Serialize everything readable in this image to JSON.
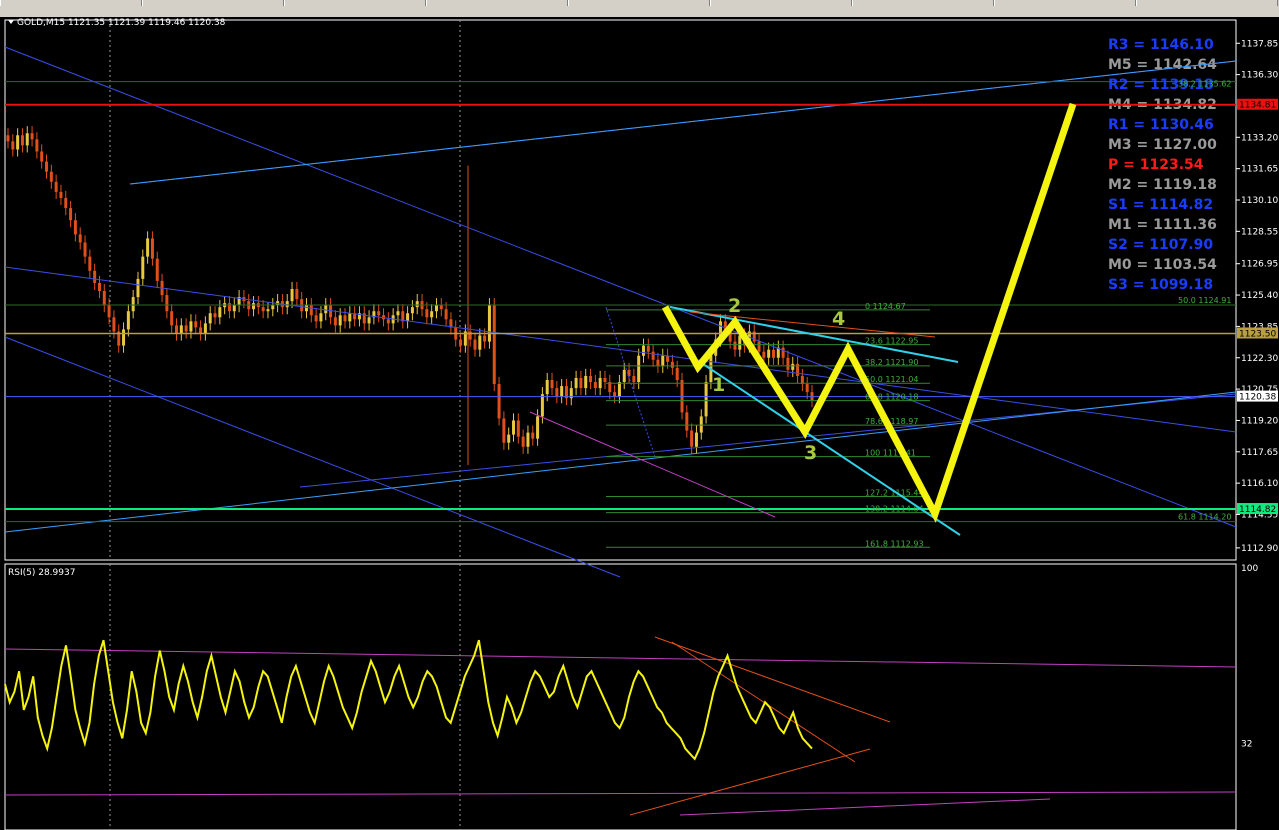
{
  "taskbar": {
    "items": [
      "...",
      "...",
      "...",
      "...",
      "...",
      "...",
      "...",
      "...",
      "..."
    ]
  },
  "chart_data": [
    {
      "type": "line",
      "symbol": "GOLD,M15",
      "ohlc": [
        "1121.35",
        "1121.39",
        "1119.46",
        "1120.38"
      ],
      "y_axis": {
        "ticks": [
          [
            "1137.85",
            1137.85
          ],
          [
            "1136.30",
            1136.3
          ],
          [
            "1133.20",
            1133.2
          ],
          [
            "1131.65",
            1131.65
          ],
          [
            "1130.10",
            1130.1
          ],
          [
            "1128.55",
            1128.55
          ],
          [
            "1126.95",
            1126.95
          ],
          [
            "1125.40",
            1125.4
          ],
          [
            "1123.85",
            1123.85
          ],
          [
            "1122.30",
            1122.3
          ],
          [
            "1120.75",
            1120.75
          ],
          [
            "1119.20",
            1119.2
          ],
          [
            "1117.65",
            1117.65
          ],
          [
            "1116.10",
            1116.1
          ],
          [
            "1114.55",
            1114.55
          ],
          [
            "1112.90",
            1112.9
          ]
        ],
        "range": [
          1112.3,
          1139.0
        ]
      },
      "price_tags": [
        {
          "label": "1134.81",
          "value": 1134.81,
          "color": "#e81010"
        },
        {
          "label": "1123.50",
          "value": 1123.5,
          "color": "#b8a040"
        },
        {
          "label": "1120.38",
          "value": 1120.38,
          "color": "#ffffff"
        },
        {
          "label": "1114.82",
          "value": 1114.82,
          "color": "#10e880"
        }
      ],
      "pivots": [
        {
          "label": "R3 = 1146.10",
          "color": "#1a3cff"
        },
        {
          "label": "M5 = 1142.64",
          "color": "#9a9a9a"
        },
        {
          "label": "R2 = 1139.18",
          "color": "#1a3cff"
        },
        {
          "label": "M4 = 1134.82",
          "color": "#9a9a9a"
        },
        {
          "label": "R1 = 1130.46",
          "color": "#1a3cff"
        },
        {
          "label": "M3 = 1127.00",
          "color": "#9a9a9a"
        },
        {
          "label": "P   = 1123.54",
          "color": "#ff1a1a"
        },
        {
          "label": "M2 = 1119.18",
          "color": "#9a9a9a"
        },
        {
          "label": "S1 = 1114.82",
          "color": "#1a3cff"
        },
        {
          "label": "M1 = 1111.36",
          "color": "#9a9a9a"
        },
        {
          "label": "S2 = 1107.90",
          "color": "#1a3cff"
        },
        {
          "label": "M0 = 1103.54",
          "color": "#9a9a9a"
        },
        {
          "label": "S3 = 1099.18",
          "color": "#1a3cff"
        }
      ],
      "fib_levels": [
        {
          "label": "0 1124.67",
          "value": 1124.67
        },
        {
          "label": "23.6 1122.95",
          "value": 1122.95
        },
        {
          "label": "38.2 1121.90",
          "value": 1121.9
        },
        {
          "label": "50.0 1121.04",
          "value": 1121.04
        },
        {
          "label": "61.8 1120.18",
          "value": 1120.18
        },
        {
          "label": "78.6 1118.97",
          "value": 1118.97
        },
        {
          "label": "100 1117.41",
          "value": 1117.41
        },
        {
          "label": "127.2 1115.44",
          "value": 1115.44
        },
        {
          "label": "138.2 1114.64",
          "value": 1114.64
        },
        {
          "label": "161.8 1112.93",
          "value": 1112.93
        }
      ],
      "right_fib_labels": [
        {
          "label": "38.2 1135.62",
          "value": 1135.62
        },
        {
          "label": "50.0 1124.91",
          "value": 1124.91
        },
        {
          "label": "61.8 1114.20",
          "value": 1114.2
        }
      ],
      "wave_labels": [
        "1",
        "2",
        "3",
        "4"
      ],
      "candles_close": [
        1133.0,
        1132.6,
        1133.3,
        1132.8,
        1133.4,
        1133.1,
        1132.5,
        1132.0,
        1131.5,
        1131.0,
        1130.5,
        1130.2,
        1129.7,
        1129.1,
        1128.4,
        1128.0,
        1127.3,
        1126.6,
        1126.0,
        1125.6,
        1124.9,
        1124.3,
        1123.6,
        1122.9,
        1123.7,
        1124.6,
        1125.3,
        1126.2,
        1127.3,
        1128.2,
        1127.2,
        1126.1,
        1125.4,
        1124.6,
        1123.9,
        1123.5,
        1123.9,
        1123.6,
        1124.1,
        1123.8,
        1123.5,
        1124.0,
        1124.5,
        1124.3,
        1124.8,
        1125.0,
        1124.6,
        1124.9,
        1125.3,
        1125.1,
        1124.7,
        1125.0,
        1124.8,
        1124.6,
        1124.7,
        1124.9,
        1125.1,
        1124.8,
        1125.1,
        1125.7,
        1125.2,
        1124.6,
        1124.9,
        1124.4,
        1124.1,
        1124.5,
        1124.9,
        1124.3,
        1123.9,
        1124.4,
        1124.1,
        1124.5,
        1124.2,
        1124.5,
        1124.0,
        1124.3,
        1124.6,
        1124.4,
        1124.2,
        1124.0,
        1124.4,
        1124.6,
        1124.1,
        1124.5,
        1124.8,
        1125.1,
        1124.7,
        1124.3,
        1124.6,
        1124.9,
        1124.7,
        1124.2,
        1123.8,
        1123.2,
        1122.9,
        1123.6,
        1123.2,
        1122.7,
        1123.4,
        1123.1,
        1124.9,
        1121.0,
        1119.3,
        1118.1,
        1118.5,
        1119.2,
        1118.4,
        1117.9,
        1118.6,
        1118.3,
        1119.4,
        1120.5,
        1121.2,
        1120.8,
        1120.4,
        1120.9,
        1120.3,
        1120.8,
        1121.3,
        1120.8,
        1121.4,
        1121.1,
        1120.8,
        1121.3,
        1121.1,
        1120.6,
        1120.4,
        1121.1,
        1121.7,
        1121.4,
        1121.1,
        1122.4,
        1122.9,
        1122.6,
        1122.2,
        1121.9,
        1122.4,
        1122.1,
        1121.8,
        1121.2,
        1119.6,
        1118.7,
        1117.9,
        1118.6,
        1119.4,
        1121.1,
        1122.4,
        1123.2,
        1124.1,
        1123.6,
        1123.1,
        1122.7,
        1123.4,
        1122.9,
        1123.6,
        1123.1,
        1122.6,
        1122.3,
        1122.7,
        1122.3,
        1122.8,
        1122.3,
        1121.7,
        1122.0,
        1121.4,
        1121.0,
        1120.6,
        1120.2
      ],
      "rsi": {
        "label": "RSI(5) 28.9937",
        "ticks": [
          [
            "100",
            100
          ],
          [
            "32",
            32
          ]
        ],
        "values": [
          55,
          48,
          52,
          60,
          45,
          50,
          58,
          42,
          35,
          30,
          38,
          50,
          62,
          70,
          58,
          45,
          38,
          32,
          40,
          55,
          66,
          72,
          60,
          48,
          40,
          34,
          45,
          60,
          52,
          40,
          36,
          44,
          58,
          68,
          60,
          50,
          45,
          55,
          62,
          56,
          48,
          42,
          50,
          60,
          66,
          58,
          50,
          44,
          52,
          60,
          56,
          48,
          42,
          46,
          54,
          60,
          58,
          52,
          46,
          40,
          50,
          58,
          62,
          56,
          50,
          44,
          40,
          48,
          56,
          62,
          58,
          52,
          46,
          42,
          38,
          44,
          52,
          58,
          64,
          60,
          54,
          48,
          52,
          58,
          62,
          56,
          50,
          46,
          50,
          56,
          60,
          58,
          54,
          48,
          42,
          40,
          46,
          52,
          58,
          62,
          66,
          72,
          60,
          48,
          40,
          35,
          42,
          50,
          46,
          40,
          44,
          50,
          56,
          60,
          58,
          54,
          50,
          52,
          58,
          62,
          56,
          50,
          46,
          52,
          58,
          60,
          56,
          52,
          48,
          44,
          40,
          38,
          42,
          50,
          56,
          60,
          58,
          54,
          50,
          46,
          44,
          40,
          38,
          36,
          34,
          30,
          28,
          26,
          30,
          36,
          44,
          52,
          58,
          62,
          66,
          60,
          54,
          50,
          46,
          42,
          40,
          44,
          48,
          46,
          42,
          38,
          36,
          40,
          44,
          38,
          34,
          32,
          30
        ]
      }
    }
  ]
}
